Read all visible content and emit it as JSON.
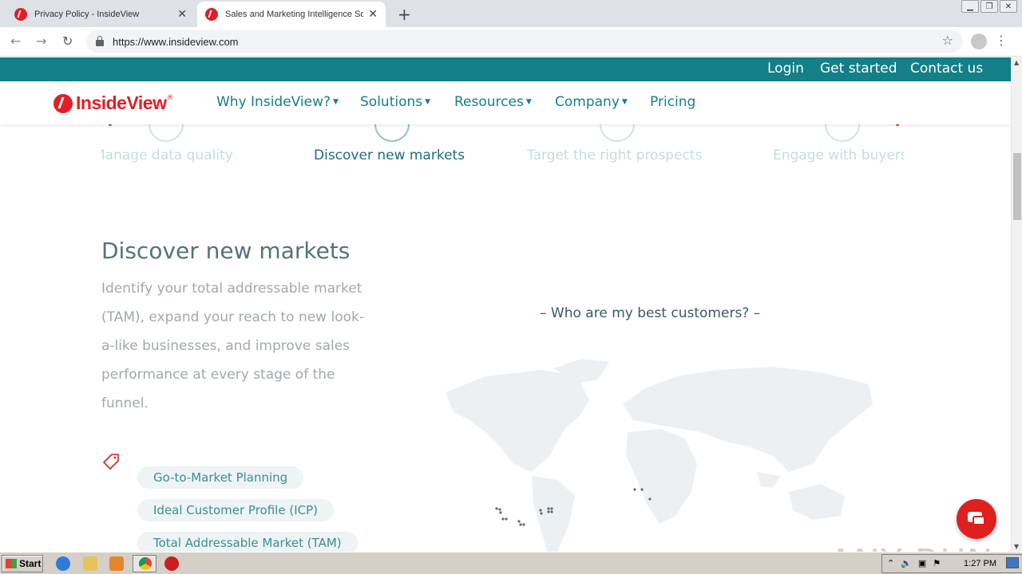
{
  "browser": {
    "tabs": [
      {
        "title": "Privacy Policy - InsideView",
        "active": false
      },
      {
        "title": "Sales and Marketing Intelligence Sof",
        "active": true
      }
    ],
    "url": "https://www.insideview.com"
  },
  "site": {
    "topbar": [
      "Login",
      "Get started",
      "Contact us"
    ],
    "logo": {
      "text": "InsideView",
      "reg": "®"
    },
    "nav": [
      {
        "label": "Why InsideView?",
        "dropdown": true
      },
      {
        "label": "Solutions",
        "dropdown": true
      },
      {
        "label": "Resources",
        "dropdown": true
      },
      {
        "label": "Company",
        "dropdown": true
      },
      {
        "label": "Pricing",
        "dropdown": false
      }
    ],
    "steps": [
      {
        "label": "Manage data quality",
        "active": false
      },
      {
        "label": "Discover new markets",
        "active": true
      },
      {
        "label": "Target the right prospects",
        "active": false
      },
      {
        "label": "Engage with buyers",
        "active": false
      }
    ],
    "section": {
      "title": "Discover new markets",
      "description": "Identify your total addressable market (TAM), expand your reach to new look-a-like businesses, and improve sales performance at every stage of the funnel.",
      "tags": [
        "Go-to-Market Planning",
        "Ideal Customer Profile (ICP)",
        "Total Addressable Market (TAM)"
      ]
    },
    "map_question": "Who are my best customers?"
  },
  "watermark": "ANY RUN",
  "taskbar": {
    "start_label": "Start",
    "clock": "1:27 PM"
  },
  "colors": {
    "brand_red": "#e21e26",
    "brand_teal": "#137f86"
  }
}
